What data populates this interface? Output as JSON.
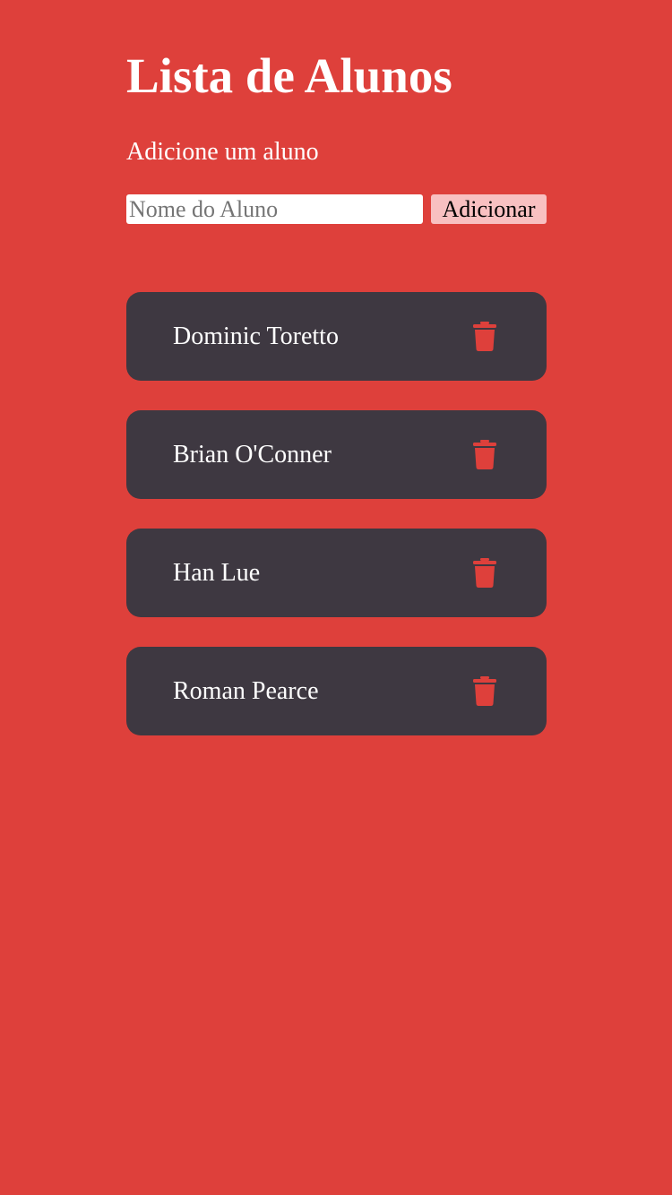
{
  "header": {
    "title": "Lista de Alunos",
    "subtitle": "Adicione um aluno"
  },
  "form": {
    "input_value": "",
    "input_placeholder": "Nome do Aluno",
    "add_label": "Adicionar"
  },
  "students": [
    {
      "name": "Dominic Toretto"
    },
    {
      "name": "Brian O'Conner"
    },
    {
      "name": "Han Lue"
    },
    {
      "name": "Roman Pearce"
    }
  ],
  "icons": {
    "delete": "trash-icon"
  },
  "colors": {
    "background": "#de403b",
    "card": "#3e3841",
    "button": "#f8c0c1",
    "icon": "#de403b",
    "text": "#ffffff"
  }
}
